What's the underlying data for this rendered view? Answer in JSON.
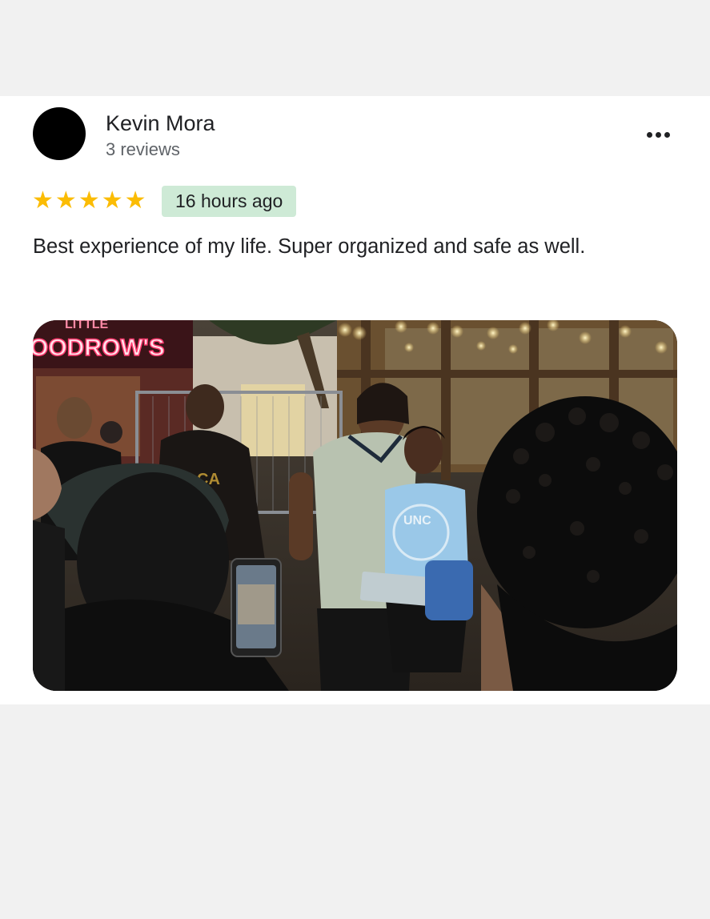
{
  "review": {
    "author_name": "Kevin Mora",
    "author_reviews": "3 reviews",
    "rating": 5,
    "rating_max": 5,
    "time_ago": "16 hours ago",
    "text": "Best experience of my life. Super organized and safe as well.",
    "more_icon": "more-horizontal-icon",
    "star_icon": "star-icon"
  },
  "photo": {
    "sign_text_top": "LITTLE",
    "sign_text": "OODROW'S",
    "shirt_text": "UNC"
  },
  "colors": {
    "star": "#fbbc04",
    "badge_bg": "#ceead6",
    "page_bg": "#f1f1f1",
    "card_bg": "#ffffff",
    "sign_neon": "#ff3a6e"
  }
}
